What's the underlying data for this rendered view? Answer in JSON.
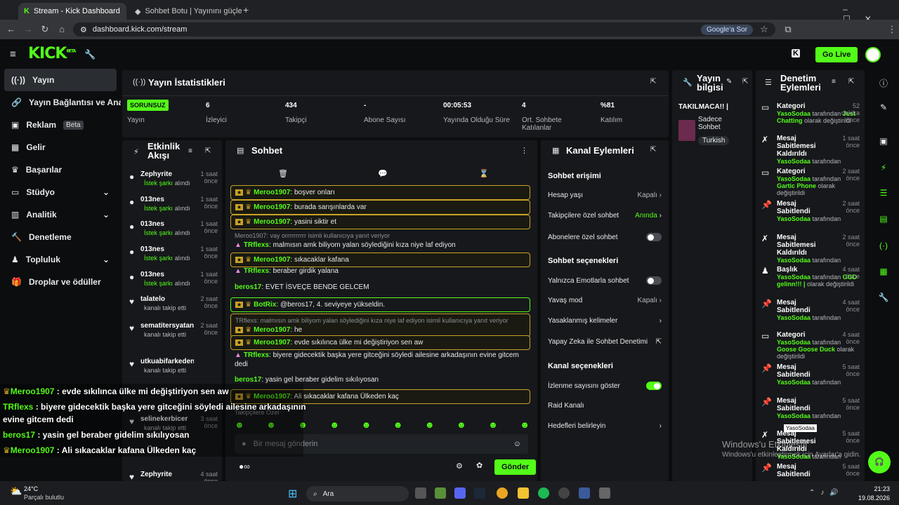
{
  "browser": {
    "tabs": [
      "Stream - Kick Dashboard",
      "Sohbet Botu | Yayınını güçlendir"
    ],
    "url": "dashboard.kick.com/stream",
    "google_btn": "Google'a Sor"
  },
  "topbar": {
    "logo": "KICK",
    "beta": "BETA",
    "go_live": "Go Live"
  },
  "sidebar": {
    "items": [
      {
        "label": "Yayın",
        "icon": "broadcast-icon"
      },
      {
        "label": "Yayın Bağlantısı ve Anahtarı",
        "icon": "link-icon"
      },
      {
        "label": "Reklam",
        "icon": "ad-icon",
        "badge": "Beta"
      },
      {
        "label": "Gelir",
        "icon": "revenue-icon"
      },
      {
        "label": "Başarılar",
        "icon": "trophy-icon"
      },
      {
        "label": "Stüdyo",
        "icon": "studio-icon"
      },
      {
        "label": "Analitik",
        "icon": "analytics-icon"
      },
      {
        "label": "Denetleme",
        "icon": "hammer-icon"
      },
      {
        "label": "Topluluk",
        "icon": "community-icon"
      },
      {
        "label": "Droplar ve ödüller",
        "icon": "gift-icon"
      }
    ]
  },
  "stats": {
    "title": "Yayın İstatistikleri",
    "status": "SORUNSUZ",
    "status_label": "Yayın",
    "items": [
      {
        "value": "6",
        "label": "İzleyici"
      },
      {
        "value": "434",
        "label": "Takipçi"
      },
      {
        "value": "-",
        "label": "Abone Sayısı"
      },
      {
        "value": "00:05:53",
        "label": "Yayında Olduğu Süre"
      },
      {
        "value": "4",
        "label": "Ort. Sohbete Katılanlar"
      },
      {
        "value": "%81",
        "label": "Katılım"
      }
    ]
  },
  "info": {
    "title": "Yayın bilgisi",
    "stream_title": "TAKILMACA!! |",
    "chat_mode": "Sadece Sohbet",
    "lang": "Turkish"
  },
  "activity": {
    "title": "Etkinlik Akışı",
    "items": [
      {
        "name": "Zephyrite",
        "time": "1 saat önce",
        "sub": "İstek şarkı",
        "suffix": "alındı"
      },
      {
        "name": "013nes",
        "time": "1 saat önce",
        "sub": "İstek şarkı",
        "suffix": "alındı"
      },
      {
        "name": "013nes",
        "time": "1 saat önce",
        "sub": "İstek şarkı",
        "suffix": "alındı"
      },
      {
        "name": "013nes",
        "time": "1 saat önce",
        "sub": "İstek şarkı",
        "suffix": "alındı"
      },
      {
        "name": "013nes",
        "time": "1 saat önce",
        "sub": "İstek şarkı",
        "suffix": "alındı"
      },
      {
        "name": "talatelo",
        "time": "2 saat önce",
        "sub": "",
        "suffix": "kanalı takip etti"
      },
      {
        "name": "sematitersyatan",
        "time": "2 saat önce",
        "sub": "",
        "suffix": "kanalı takip etti"
      },
      {
        "name": "utkuabifarkedenekada",
        "time": "",
        "sub": "",
        "suffix": "kanalı takip etti"
      },
      {
        "name": "selinekerbicer",
        "time": "3 saat önce",
        "sub": "",
        "suffix": "kanalı takip etti"
      },
      {
        "name": "Zephyrite",
        "time": "4 saat önce",
        "sub": "",
        "suffix": ""
      }
    ]
  },
  "chat": {
    "title": "Sohbet",
    "placeholder": "Bir mesaj gönderin",
    "send": "Gönder",
    "followers_only": "Takipçilere Özel",
    "messages": [
      {
        "user": "Meroo1907",
        "text": "boşver onları",
        "style": "hl"
      },
      {
        "user": "Meroo1907",
        "text": "burada sarışınlarda var",
        "style": "hl"
      },
      {
        "user": "Meroo1907",
        "text": "yasini siktir et",
        "style": "hl"
      },
      {
        "reply": "Meroo1907: vay orrrrrrrrrr isimli kullanıcıya yanıt veriyor",
        "user": "TRflexs",
        "text": "malmısın amk biliyom yalan söylediğini kıza niye laf ediyon",
        "style": "plain"
      },
      {
        "user": "Meroo1907",
        "text": "sıkacaklar kafana",
        "style": "hl"
      },
      {
        "user": "TRflexs",
        "text": "beraber girdik yalana",
        "style": "plain"
      },
      {
        "user": "beros17",
        "text": "EVET İSVEÇE BENDE GELCEM",
        "style": "plain"
      },
      {
        "user": "BotRix",
        "text": "@beros17, 4. seviyeye yükseldin.",
        "style": "hlg"
      },
      {
        "reply": "TRflexs: malmısın amk biliyom yalan söylediğini kıza niye laf ediyon isimli kullanıcıya yanıt veriyor",
        "user": "Meroo1907",
        "text": "he",
        "style": "hl"
      },
      {
        "user": "Meroo1907",
        "text": "evde sıkılınca ülke mi değiştiriyon sen aw",
        "style": "hl"
      },
      {
        "user": "TRflexs",
        "text": "biyere gidecektik başka yere gitceğini söyledi ailesine arkadaşının evine gitcem dedi",
        "style": "plain"
      },
      {
        "user": "beros17",
        "text": "yasin gel beraber gidelim sıkılıyosan",
        "style": "plain"
      },
      {
        "user": "Meroo1907",
        "text": "Ali sıkacaklar kafana Ülkeden kaç",
        "style": "hl"
      }
    ]
  },
  "channel": {
    "title": "Kanal Eylemleri",
    "s1": "Sohbet erişimi",
    "s2": "Sohbet seçenekleri",
    "s3": "Kanal seçenekleri",
    "rows1": [
      {
        "label": "Hesap yaşı",
        "value": "Kapalı"
      },
      {
        "label": "Takipçilere özel sohbet",
        "value": "Anında"
      },
      {
        "label": "Abonelere özel sohbet",
        "value": ""
      }
    ],
    "rows2": [
      {
        "label": "Yalnızca Emotlarla sohbet",
        "value": ""
      },
      {
        "label": "Yavaş mod",
        "value": "Kapalı"
      },
      {
        "label": "Yasaklanmış kelimeler",
        "value": ""
      },
      {
        "label": "Yapay Zeka ile Sohbet Denetimi",
        "value": ""
      }
    ],
    "rows3": [
      {
        "label": "İzlenme sayısını göster",
        "value": ""
      },
      {
        "label": "Raid Kanalı",
        "value": ""
      },
      {
        "label": "Hedefleri belirleyin",
        "value": ""
      }
    ]
  },
  "moderation": {
    "title": "Denetim Eylemleri",
    "items": [
      {
        "title": "Kategori",
        "time": "52 dakika önce",
        "user": "YasoSodaa",
        "desc": "tarafından",
        "desc2": "Just Chatting",
        "desc3": "olarak değiştirildi",
        "icon": "category-icon"
      },
      {
        "title": "Mesaj Sabitlemesi Kaldırıldı",
        "time": "1 saat önce",
        "user": "YasoSodaa",
        "desc": "tarafından",
        "icon": "unpin-icon"
      },
      {
        "title": "Kategori",
        "time": "2 saat önce",
        "user": "YasoSodaa",
        "desc": "tarafından",
        "desc2": "Gartic Phone",
        "desc3": "olarak değiştirildi",
        "icon": "category-icon"
      },
      {
        "title": "Mesaj Sabitlendi",
        "time": "2 saat önce",
        "user": "YasoSodaa",
        "desc": "tarafından",
        "icon": "pin-icon"
      },
      {
        "title": "Mesaj Sabitlemesi Kaldırıldı",
        "time": "2 saat önce",
        "user": "YasoSodaa",
        "desc": "tarafından",
        "icon": "unpin-icon"
      },
      {
        "title": "Başlık",
        "time": "4 saat önce",
        "user": "YasoSodaa",
        "desc": "tarafından",
        "desc2": "GGD gelinn!!! |",
        "desc3": "olarak değiştirildi",
        "icon": "title-icon"
      },
      {
        "title": "Mesaj Sabitlendi",
        "time": "4 saat önce",
        "user": "YasoSodaa",
        "desc": "tarafından",
        "icon": "pin-icon"
      },
      {
        "title": "Kategori",
        "time": "4 saat önce",
        "user": "YasoSodaa",
        "desc": "tarafından",
        "desc2": "Goose Goose Duck",
        "desc3": "olarak değiştirildi",
        "icon": "category-icon"
      },
      {
        "title": "Mesaj Sabitlendi",
        "time": "5 saat önce",
        "user": "YasoSodaa",
        "desc": "tarafından",
        "icon": "pin-icon"
      },
      {
        "title": "Mesaj Sabitlendi",
        "time": "5 saat önce",
        "user": "YasoSodaa",
        "desc": "tarafından",
        "icon": "pin-icon"
      },
      {
        "title": "Mesaj Sabitlemesi Kaldırıldı",
        "time": "5 saat önce",
        "user": "YasoSodaa",
        "desc": "tarafından",
        "icon": "unpin-icon"
      },
      {
        "title": "Mesaj Sabitlendi",
        "time": "5 saat önce",
        "user": "",
        "desc": "",
        "icon": "pin-icon"
      }
    ],
    "tooltip": "YasoSodaa"
  },
  "overlay": [
    {
      "user": "Meroo1907",
      "text": " : evde sıkılınca ülke mi değiştiriyon sen aw"
    },
    {
      "user": "TRflexs",
      "text": " : biyere gidecektik başka yere gitceğini söyledi ailesine arkadaşının"
    },
    {
      "user": "",
      "text": "evine gitcem dedi"
    },
    {
      "user": "beros17",
      "text": " : yasin gel beraber gidelim sıkılıyosan"
    },
    {
      "user": "Meroo1907",
      "text": " : Ali sıkacaklar kafana Ülkeden kaç"
    }
  ],
  "watermark": {
    "line1": "Windows'u Etkinleştir",
    "line2": "Windows'u etkinleştirmek için Ayarlar'a gidin."
  },
  "taskbar": {
    "temp": "24°C",
    "weather": "Parçalı bulutlu",
    "search": "Ara",
    "time": "21:23",
    "date": "19.08.2026"
  }
}
